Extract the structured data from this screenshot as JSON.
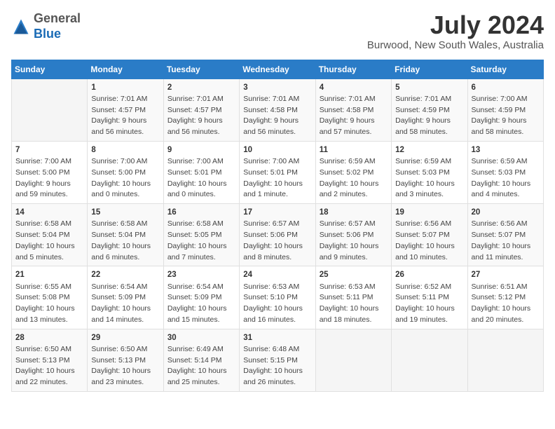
{
  "logo": {
    "general": "General",
    "blue": "Blue"
  },
  "header": {
    "month_year": "July 2024",
    "location": "Burwood, New South Wales, Australia"
  },
  "weekdays": [
    "Sunday",
    "Monday",
    "Tuesday",
    "Wednesday",
    "Thursday",
    "Friday",
    "Saturday"
  ],
  "weeks": [
    [
      {
        "day": "",
        "info": ""
      },
      {
        "day": "1",
        "info": "Sunrise: 7:01 AM\nSunset: 4:57 PM\nDaylight: 9 hours\nand 56 minutes."
      },
      {
        "day": "2",
        "info": "Sunrise: 7:01 AM\nSunset: 4:57 PM\nDaylight: 9 hours\nand 56 minutes."
      },
      {
        "day": "3",
        "info": "Sunrise: 7:01 AM\nSunset: 4:58 PM\nDaylight: 9 hours\nand 56 minutes."
      },
      {
        "day": "4",
        "info": "Sunrise: 7:01 AM\nSunset: 4:58 PM\nDaylight: 9 hours\nand 57 minutes."
      },
      {
        "day": "5",
        "info": "Sunrise: 7:01 AM\nSunset: 4:59 PM\nDaylight: 9 hours\nand 58 minutes."
      },
      {
        "day": "6",
        "info": "Sunrise: 7:00 AM\nSunset: 4:59 PM\nDaylight: 9 hours\nand 58 minutes."
      }
    ],
    [
      {
        "day": "7",
        "info": "Sunrise: 7:00 AM\nSunset: 5:00 PM\nDaylight: 9 hours\nand 59 minutes."
      },
      {
        "day": "8",
        "info": "Sunrise: 7:00 AM\nSunset: 5:00 PM\nDaylight: 10 hours\nand 0 minutes."
      },
      {
        "day": "9",
        "info": "Sunrise: 7:00 AM\nSunset: 5:01 PM\nDaylight: 10 hours\nand 0 minutes."
      },
      {
        "day": "10",
        "info": "Sunrise: 7:00 AM\nSunset: 5:01 PM\nDaylight: 10 hours\nand 1 minute."
      },
      {
        "day": "11",
        "info": "Sunrise: 6:59 AM\nSunset: 5:02 PM\nDaylight: 10 hours\nand 2 minutes."
      },
      {
        "day": "12",
        "info": "Sunrise: 6:59 AM\nSunset: 5:03 PM\nDaylight: 10 hours\nand 3 minutes."
      },
      {
        "day": "13",
        "info": "Sunrise: 6:59 AM\nSunset: 5:03 PM\nDaylight: 10 hours\nand 4 minutes."
      }
    ],
    [
      {
        "day": "14",
        "info": "Sunrise: 6:58 AM\nSunset: 5:04 PM\nDaylight: 10 hours\nand 5 minutes."
      },
      {
        "day": "15",
        "info": "Sunrise: 6:58 AM\nSunset: 5:04 PM\nDaylight: 10 hours\nand 6 minutes."
      },
      {
        "day": "16",
        "info": "Sunrise: 6:58 AM\nSunset: 5:05 PM\nDaylight: 10 hours\nand 7 minutes."
      },
      {
        "day": "17",
        "info": "Sunrise: 6:57 AM\nSunset: 5:06 PM\nDaylight: 10 hours\nand 8 minutes."
      },
      {
        "day": "18",
        "info": "Sunrise: 6:57 AM\nSunset: 5:06 PM\nDaylight: 10 hours\nand 9 minutes."
      },
      {
        "day": "19",
        "info": "Sunrise: 6:56 AM\nSunset: 5:07 PM\nDaylight: 10 hours\nand 10 minutes."
      },
      {
        "day": "20",
        "info": "Sunrise: 6:56 AM\nSunset: 5:07 PM\nDaylight: 10 hours\nand 11 minutes."
      }
    ],
    [
      {
        "day": "21",
        "info": "Sunrise: 6:55 AM\nSunset: 5:08 PM\nDaylight: 10 hours\nand 13 minutes."
      },
      {
        "day": "22",
        "info": "Sunrise: 6:54 AM\nSunset: 5:09 PM\nDaylight: 10 hours\nand 14 minutes."
      },
      {
        "day": "23",
        "info": "Sunrise: 6:54 AM\nSunset: 5:09 PM\nDaylight: 10 hours\nand 15 minutes."
      },
      {
        "day": "24",
        "info": "Sunrise: 6:53 AM\nSunset: 5:10 PM\nDaylight: 10 hours\nand 16 minutes."
      },
      {
        "day": "25",
        "info": "Sunrise: 6:53 AM\nSunset: 5:11 PM\nDaylight: 10 hours\nand 18 minutes."
      },
      {
        "day": "26",
        "info": "Sunrise: 6:52 AM\nSunset: 5:11 PM\nDaylight: 10 hours\nand 19 minutes."
      },
      {
        "day": "27",
        "info": "Sunrise: 6:51 AM\nSunset: 5:12 PM\nDaylight: 10 hours\nand 20 minutes."
      }
    ],
    [
      {
        "day": "28",
        "info": "Sunrise: 6:50 AM\nSunset: 5:13 PM\nDaylight: 10 hours\nand 22 minutes."
      },
      {
        "day": "29",
        "info": "Sunrise: 6:50 AM\nSunset: 5:13 PM\nDaylight: 10 hours\nand 23 minutes."
      },
      {
        "day": "30",
        "info": "Sunrise: 6:49 AM\nSunset: 5:14 PM\nDaylight: 10 hours\nand 25 minutes."
      },
      {
        "day": "31",
        "info": "Sunrise: 6:48 AM\nSunset: 5:15 PM\nDaylight: 10 hours\nand 26 minutes."
      },
      {
        "day": "",
        "info": ""
      },
      {
        "day": "",
        "info": ""
      },
      {
        "day": "",
        "info": ""
      }
    ]
  ]
}
